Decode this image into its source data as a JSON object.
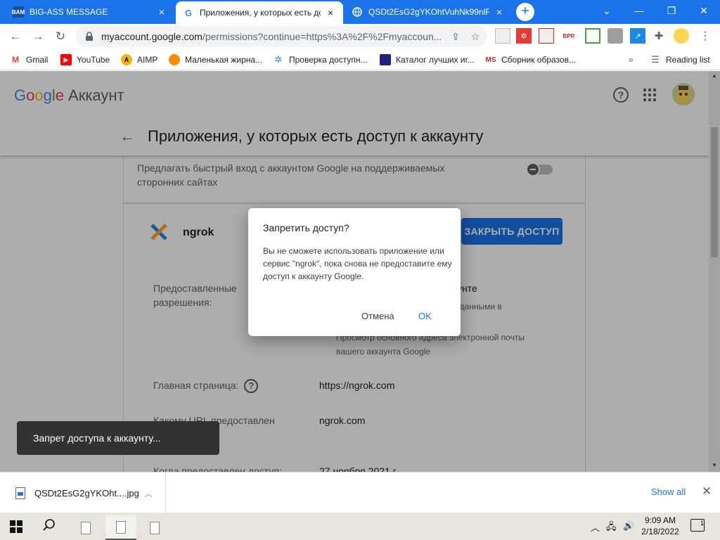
{
  "browser": {
    "tabs": [
      {
        "title": "BIG-ASS MESSAGE",
        "favicon": "BAM",
        "close": "×"
      },
      {
        "title": "Приложения, у которых есть до",
        "favicon": "G",
        "close": "×"
      },
      {
        "title": "QSDt2EsG2gYKOhtVuhNk99nlFe",
        "favicon": "globe",
        "close": "×"
      }
    ],
    "new_tab": "+",
    "url_host": "myaccount.google.com",
    "url_rest": "/permissions?continue=https%3A%2F%2Fmyaccoun...",
    "bookmarks": [
      {
        "label": "Gmail",
        "icon": "M",
        "color": "#ea4335"
      },
      {
        "label": "YouTube",
        "icon": "▶",
        "color": "#ff0000"
      },
      {
        "label": "AIMP",
        "icon": "A",
        "color": "#f4b400"
      },
      {
        "label": "Маленькая жирна...",
        "icon": "●",
        "color": "#ff8a00"
      },
      {
        "label": "Проверка доступн...",
        "icon": "✲",
        "color": "#1e88e5"
      },
      {
        "label": "Каталог лучших иг...",
        "icon": "■",
        "color": "#1a237e"
      },
      {
        "label": "Сборник образов...",
        "icon": "MS",
        "color": "#c62828"
      }
    ],
    "bookmarks_more": "»",
    "reading_list": "Reading list"
  },
  "account_page": {
    "logo_google": "Google",
    "logo_account": "Аккаунт",
    "page_title": "Приложения, у которых есть доступ к аккаунту",
    "signin_text": "Предлагать быстрый вход с аккаунтом Google на поддерживаемых сторонних сайтах",
    "app_name": "ngrok",
    "revoke_button": "ЗАКРЫТЬ ДОСТУП",
    "granted_label": "Предоставленные разрешения:",
    "granted_heading": "аккаунте",
    "granted_line1": "ными данными в",
    "granted_line2": "Просмотр основного адреса электронной почты",
    "granted_line3": "вашего аккаунта Google",
    "homepage_label": "Главная страница:",
    "homepage_value": "https://ngrok.com",
    "url_label": "Какому URL предоставлен",
    "url_value": "ngrok.com",
    "date_label": "Когда предоставлен доступ:",
    "date_value": "27 ноября 2021 г."
  },
  "dialog": {
    "title": "Запретить доступ?",
    "body": "Вы не сможете использовать приложение или сервис \"ngrok\", пока снова не предоставите ему доступ к аккаунту Google.",
    "cancel": "Отмена",
    "ok": "OK"
  },
  "toast": {
    "text": "Запрет доступа к аккаунту..."
  },
  "downloads": {
    "file_name": "QSDt2EsG2gYKOht....jpg",
    "show_all": "Show all",
    "close": "✕"
  },
  "taskbar": {
    "time": "9:09 AM",
    "date": "2/18/2022",
    "notifications": "1"
  }
}
